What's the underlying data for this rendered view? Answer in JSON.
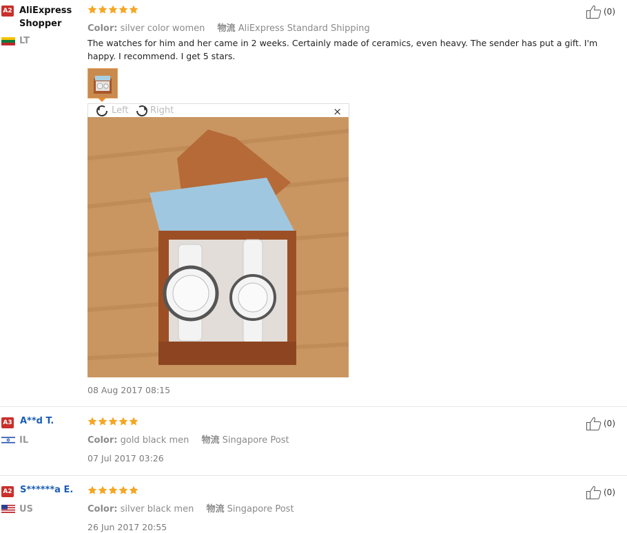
{
  "reviews": [
    {
      "badge": "A2",
      "user": "AliExpress Shopper",
      "country": "LT",
      "color_label": "Color:",
      "color_value": "silver color women",
      "shipping_label": "物流",
      "shipping_value": "AliExpress Standard Shipping",
      "text": "The watches for him and her came in 2 weeks. Certainly made of ceramics, even heavy. The sender has put a gift. I'm happy. I recommend. I get 5 stars.",
      "date": "08 Aug 2017 08:15",
      "helpful": "(0)"
    },
    {
      "badge": "A3",
      "user": "A**d T.",
      "country": "IL",
      "color_label": "Color:",
      "color_value": "gold black men",
      "shipping_label": "物流",
      "shipping_value": "Singapore Post",
      "date": "07 Jul 2017 03:26",
      "helpful": "(0)"
    },
    {
      "badge": "A2",
      "user": "S******a E.",
      "country": "US",
      "color_label": "Color:",
      "color_value": "silver black men",
      "shipping_label": "物流",
      "shipping_value": "Singapore Post",
      "date": "26 Jun 2017 20:55",
      "helpful": "(0)"
    }
  ],
  "viewer": {
    "rotate_left": "Left",
    "rotate_right": "Right",
    "close": "×"
  },
  "colors": {
    "star": "#f5a623",
    "badge": "#c9302c",
    "link": "#1a5db5"
  },
  "icons": {
    "helpful": "thumbs-up-icon",
    "rotate_left": "rotate-left-icon",
    "rotate_right": "rotate-right-icon",
    "close": "close-icon"
  }
}
